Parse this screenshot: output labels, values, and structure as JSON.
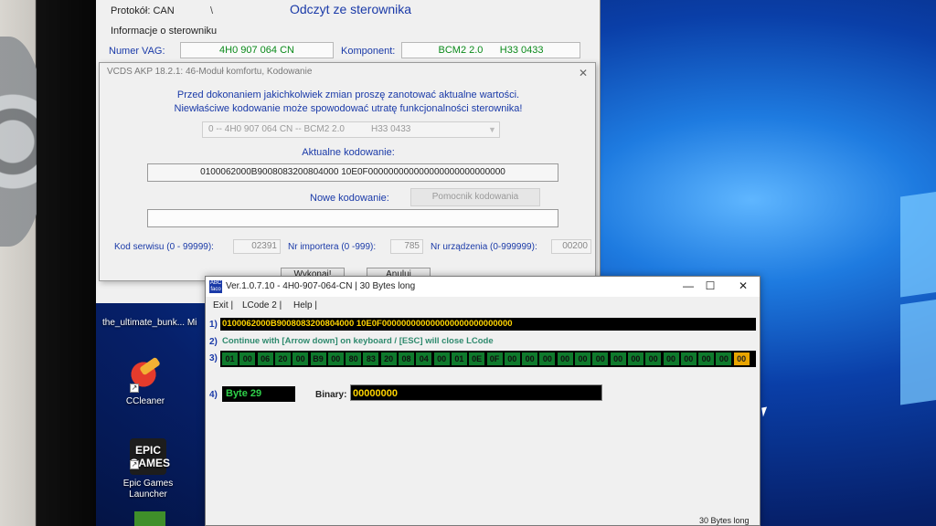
{
  "vcds_main": {
    "protocol": "Protokół: CAN",
    "tick": "\\",
    "title": "Odczyt ze sterownika",
    "info_label": "Informacje o sterowniku",
    "vag_label": "Numer VAG:",
    "vag_value": "4H0 907 064 CN",
    "component_label": "Komponent:",
    "component_value": "BCM2 2.0      H33 0433"
  },
  "coding_dialog": {
    "title": "VCDS AKP 18.2.1: 46-Moduł komfortu,  Kodowanie",
    "close": "✕",
    "warning_line1": "Przed dokonaniem jakichkolwiek zmian proszę zanotować aktualne wartości.",
    "warning_line2": "Niewłaściwe kodowanie może spowodować utratę funkcjonalności sterownika!",
    "module_select_a": "0 -- 4H0 907 064 CN -- BCM2 2.0",
    "module_select_b": "H33 0433",
    "current_coding_label": "Aktualne kodowanie:",
    "current_coding_value": "0100062000B9008083200804000 10E0F000000000000000000000000000",
    "new_coding_label": "Nowe kodowanie:",
    "helper_button": "Pomocnik kodowania",
    "new_coding_value": "",
    "service_code_label": "Kod serwisu (0 - 99999):",
    "service_code_value": "02391",
    "importer_label": "Nr importera (0 -999):",
    "importer_value": "785",
    "device_label": "Nr urządzenia (0-999999):",
    "device_value": "00200",
    "execute_button": "Wykonaj!",
    "cancel_button": "Anuluj"
  },
  "lcode": {
    "title": "Ver.1.0.7.10 -    4H0-907-064-CN | 30 Bytes long",
    "app_icon": "ABC\nfaco",
    "minimize": "—",
    "maximize": "☐",
    "close": "✕",
    "menu": [
      "Exit |",
      "LCode 2 |",
      "Help |"
    ],
    "row_labels": [
      "1)",
      "2)",
      "3)",
      "4)"
    ],
    "hex_line": "0100062000B9008083200804000 10E0F000000000000000000000000000",
    "hint": "Continue with [Arrow down] on keyboard / [ESC] will close LCode",
    "bytes": [
      "01",
      "00",
      "06",
      "20",
      "00",
      "B9",
      "00",
      "80",
      "83",
      "20",
      "08",
      "04",
      "00",
      "01",
      "0E",
      "0F",
      "00",
      "00",
      "00",
      "00",
      "00",
      "00",
      "00",
      "00",
      "00",
      "00",
      "00",
      "00",
      "00",
      "00"
    ],
    "selected_byte": "Byte 29",
    "binary_label": "Binary:",
    "binary_value": "00000000",
    "status": "30 Bytes long"
  },
  "desktop": {
    "taskbar_item": "the_ultimate_bunk...     Mi",
    "icons": [
      {
        "label": "CCleaner",
        "icon": "ccleaner-icon"
      },
      {
        "label": "Epic Games Launcher",
        "icon": "epic-games-icon"
      }
    ],
    "epic_logo": "EPIC\nGAMES"
  }
}
